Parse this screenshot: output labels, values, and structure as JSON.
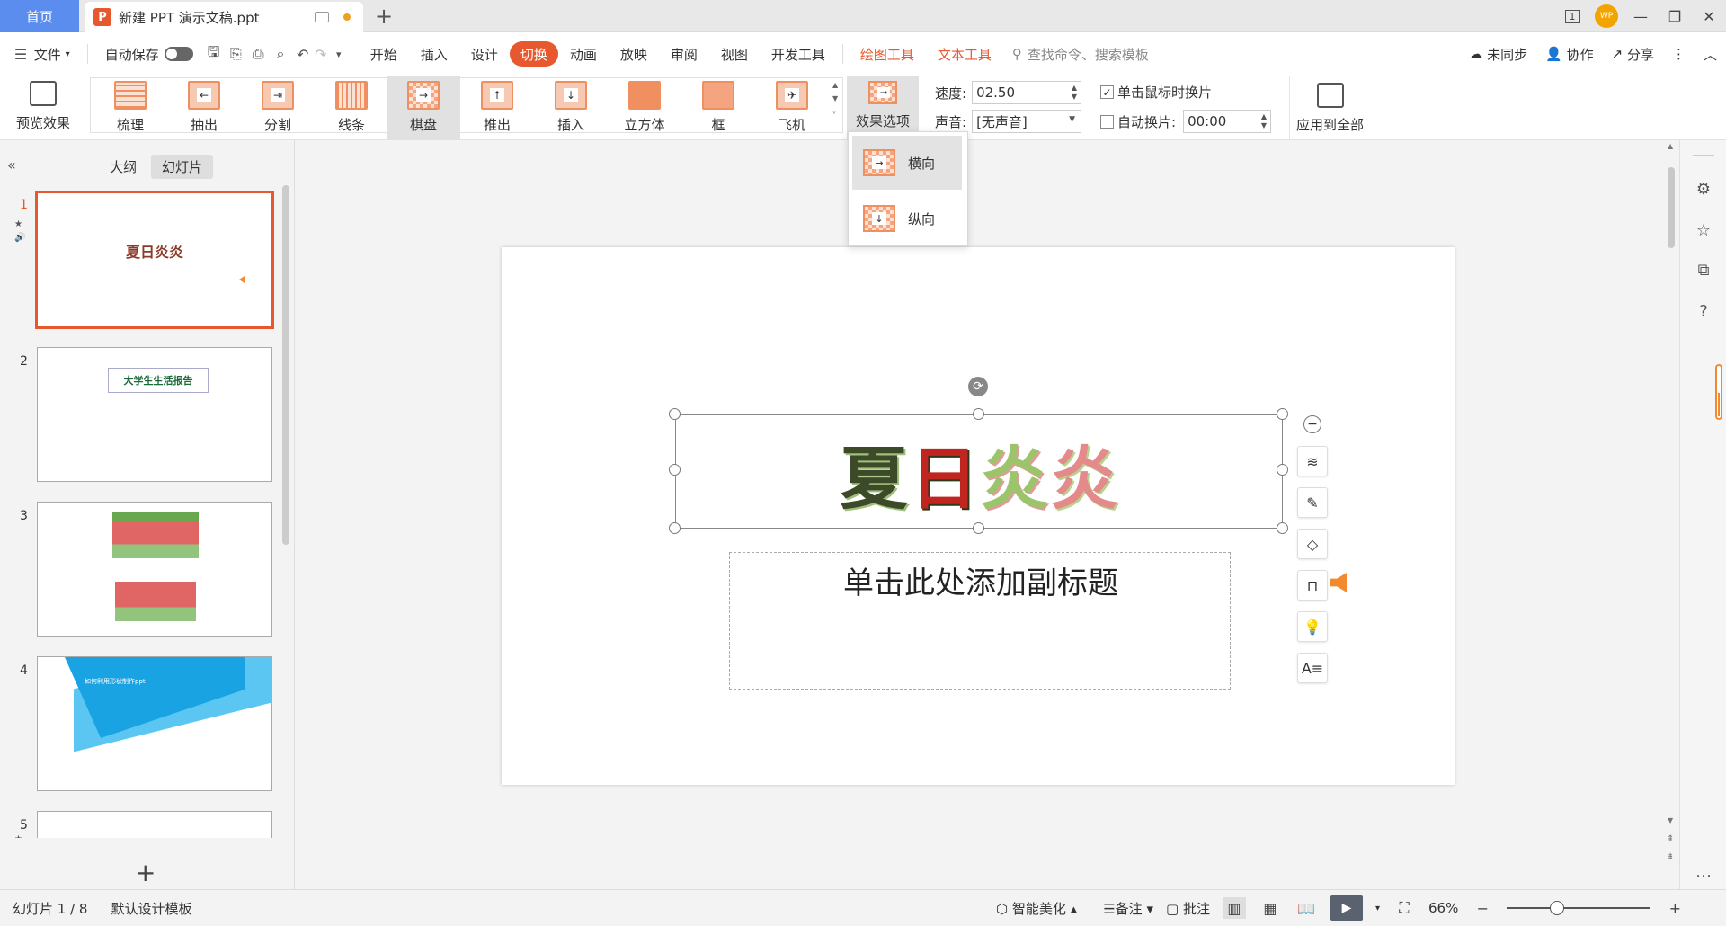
{
  "tabs": {
    "home": "首页",
    "doc": "新建 PPT 演示文稿.ppt",
    "new_tab": "+",
    "ppt_logo": "P"
  },
  "window": {
    "icon1": "1",
    "avatar": "WP",
    "min": "—",
    "max": "❐",
    "close": "✕"
  },
  "menu": {
    "file": "文件",
    "autosave": "自动保存",
    "items": [
      "开始",
      "插入",
      "设计",
      "切换",
      "动画",
      "放映",
      "审阅",
      "视图",
      "开发工具"
    ],
    "ctx": [
      "绘图工具",
      "文本工具"
    ],
    "search": "查找命令、搜索模板",
    "sync": "未同步",
    "collab": "协作",
    "share": "分享"
  },
  "ribbon": {
    "preview": "预览效果",
    "transitions": [
      "梳理",
      "抽出",
      "分割",
      "线条",
      "棋盘",
      "推出",
      "插入",
      "立方体",
      "框",
      "飞机"
    ],
    "effect_options": "效果选项",
    "speed_label": "速度:",
    "speed_value": "02.50",
    "sound_label": "声音:",
    "sound_value": "[无声音]",
    "on_click": "单击鼠标时换片",
    "auto_label": "自动换片:",
    "auto_value": "00:00",
    "apply_all": "应用到全部"
  },
  "dropdown": {
    "items": [
      "横向",
      "纵向"
    ]
  },
  "panel": {
    "tabs": [
      "大纲",
      "幻灯片"
    ],
    "slides": [
      {
        "num": "1",
        "title": "夏日炎炎"
      },
      {
        "num": "2",
        "title": "大学生生活报告"
      },
      {
        "num": "3"
      },
      {
        "num": "4",
        "title": "如何利用形状制作ppt"
      },
      {
        "num": "5"
      }
    ],
    "add": "+"
  },
  "slide": {
    "title_chars": [
      "夏",
      "日",
      "炎",
      "炎"
    ],
    "subtitle": "单击此处添加副标题"
  },
  "status": {
    "slide_info": "幻灯片 1 / 8",
    "template": "默认设计模板",
    "beautify": "智能美化",
    "notes": "备注",
    "comments": "批注",
    "zoom": "66%"
  }
}
